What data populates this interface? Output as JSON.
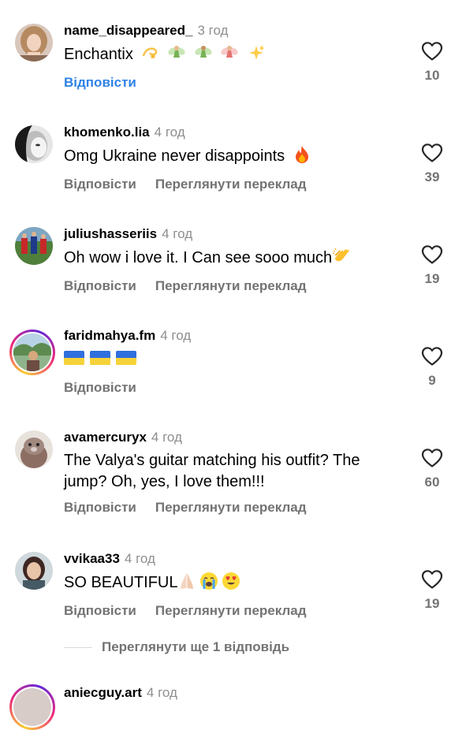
{
  "comments": [
    {
      "username": "name_disappeared_",
      "time": "3 год",
      "text": "Enchantix",
      "emojis": [
        "dizzy",
        "fairy",
        "fairy",
        "fairy",
        "sparkles"
      ],
      "reply": "Відповісти",
      "reply_color": "#2f83e5",
      "likes": "10",
      "avatar": "avatar-girl-blonde"
    },
    {
      "username": "khomenko.lia",
      "time": "4 год",
      "text": "Omg Ukraine never disappoints",
      "emojis": [
        "fire"
      ],
      "reply": "Відповісти",
      "translate": "Переглянути переклад",
      "likes": "39",
      "avatar": "avatar-bw-portrait"
    },
    {
      "username": "juliushasseriis",
      "time": "4 год",
      "text": "Oh wow i love it. I Can see sooo much",
      "emojis": [
        "clapping-hands"
      ],
      "reply": "Відповісти",
      "translate": "Переглянути переклад",
      "likes": "19",
      "avatar": "avatar-football-team"
    },
    {
      "username": "faridmahya.fm",
      "time": "4 год",
      "text": "",
      "emojis": [
        "flag-ukraine",
        "flag-ukraine",
        "flag-ukraine"
      ],
      "reply": "Відповісти",
      "likes": "9",
      "avatar": "avatar-outdoor-story-ring"
    },
    {
      "username": "avamercuryx",
      "time": "4 год",
      "text": "The Valya's guitar matching his outfit? The jump? Oh, yes, I love them!!!",
      "emojis": [],
      "reply": "Відповісти",
      "translate": "Переглянути переклад",
      "likes": "60",
      "avatar": "avatar-otter"
    },
    {
      "username": "vvikaa33",
      "time": "4 год",
      "text": "SO BEAUTIFUL",
      "emojis": [
        "folded-hands",
        "loudly-crying",
        "heart-eyes"
      ],
      "reply": "Відповісти",
      "translate": "Переглянути переклад",
      "likes": "19",
      "avatar": "avatar-girl-selfie"
    },
    {
      "username": "aniecguy.art",
      "time": "4 год",
      "avatar": "avatar-partial-ring"
    }
  ],
  "more_replies": "Переглянути ще 1 відповідь",
  "colors": {
    "username": "#000000",
    "secondary": "#737373",
    "link_blue": "#2f83e5"
  }
}
